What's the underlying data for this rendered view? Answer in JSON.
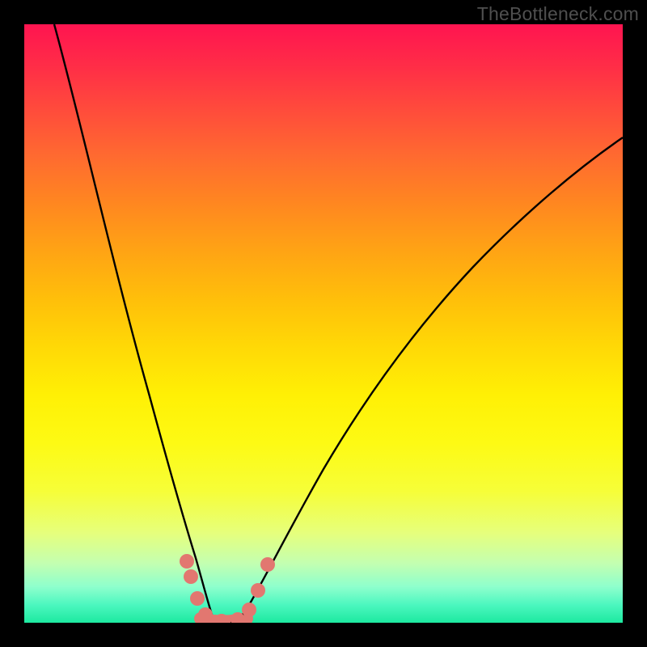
{
  "watermark": "TheBottleneck.com",
  "chart_data": {
    "type": "line",
    "title": "",
    "xlabel": "",
    "ylabel": "",
    "xlim": [
      0,
      100
    ],
    "ylim": [
      0,
      100
    ],
    "background_gradient": {
      "direction": "vertical",
      "stops": [
        {
          "pos": 0,
          "color": "#ff1450"
        },
        {
          "pos": 50,
          "color": "#ffd906"
        },
        {
          "pos": 80,
          "color": "#f6fe38"
        },
        {
          "pos": 100,
          "color": "#1de9a0"
        }
      ]
    },
    "series": [
      {
        "name": "left-branch",
        "x": [
          5,
          10,
          15,
          20,
          23,
          26,
          29,
          30.5
        ],
        "y": [
          100,
          79,
          58,
          36,
          22,
          11,
          3,
          0
        ]
      },
      {
        "name": "right-branch",
        "x": [
          36.5,
          40,
          45,
          52,
          60,
          70,
          82,
          95,
          100
        ],
        "y": [
          0,
          3,
          10,
          22,
          36,
          50,
          64,
          76,
          80
        ]
      },
      {
        "name": "valley-floor",
        "x": [
          30.5,
          32,
          34,
          36.5
        ],
        "y": [
          0,
          -0.5,
          -0.5,
          0
        ]
      }
    ],
    "highlight_points": [
      {
        "x": 27,
        "y": 10
      },
      {
        "x": 28,
        "y": 7
      },
      {
        "x": 30,
        "y": 2
      },
      {
        "x": 31,
        "y": 0.5
      },
      {
        "x": 33,
        "y": 0
      },
      {
        "x": 35,
        "y": 0.5
      },
      {
        "x": 37,
        "y": 2
      },
      {
        "x": 39,
        "y": 6
      },
      {
        "x": 40.5,
        "y": 10
      }
    ],
    "highlight_color": "#e27770"
  }
}
